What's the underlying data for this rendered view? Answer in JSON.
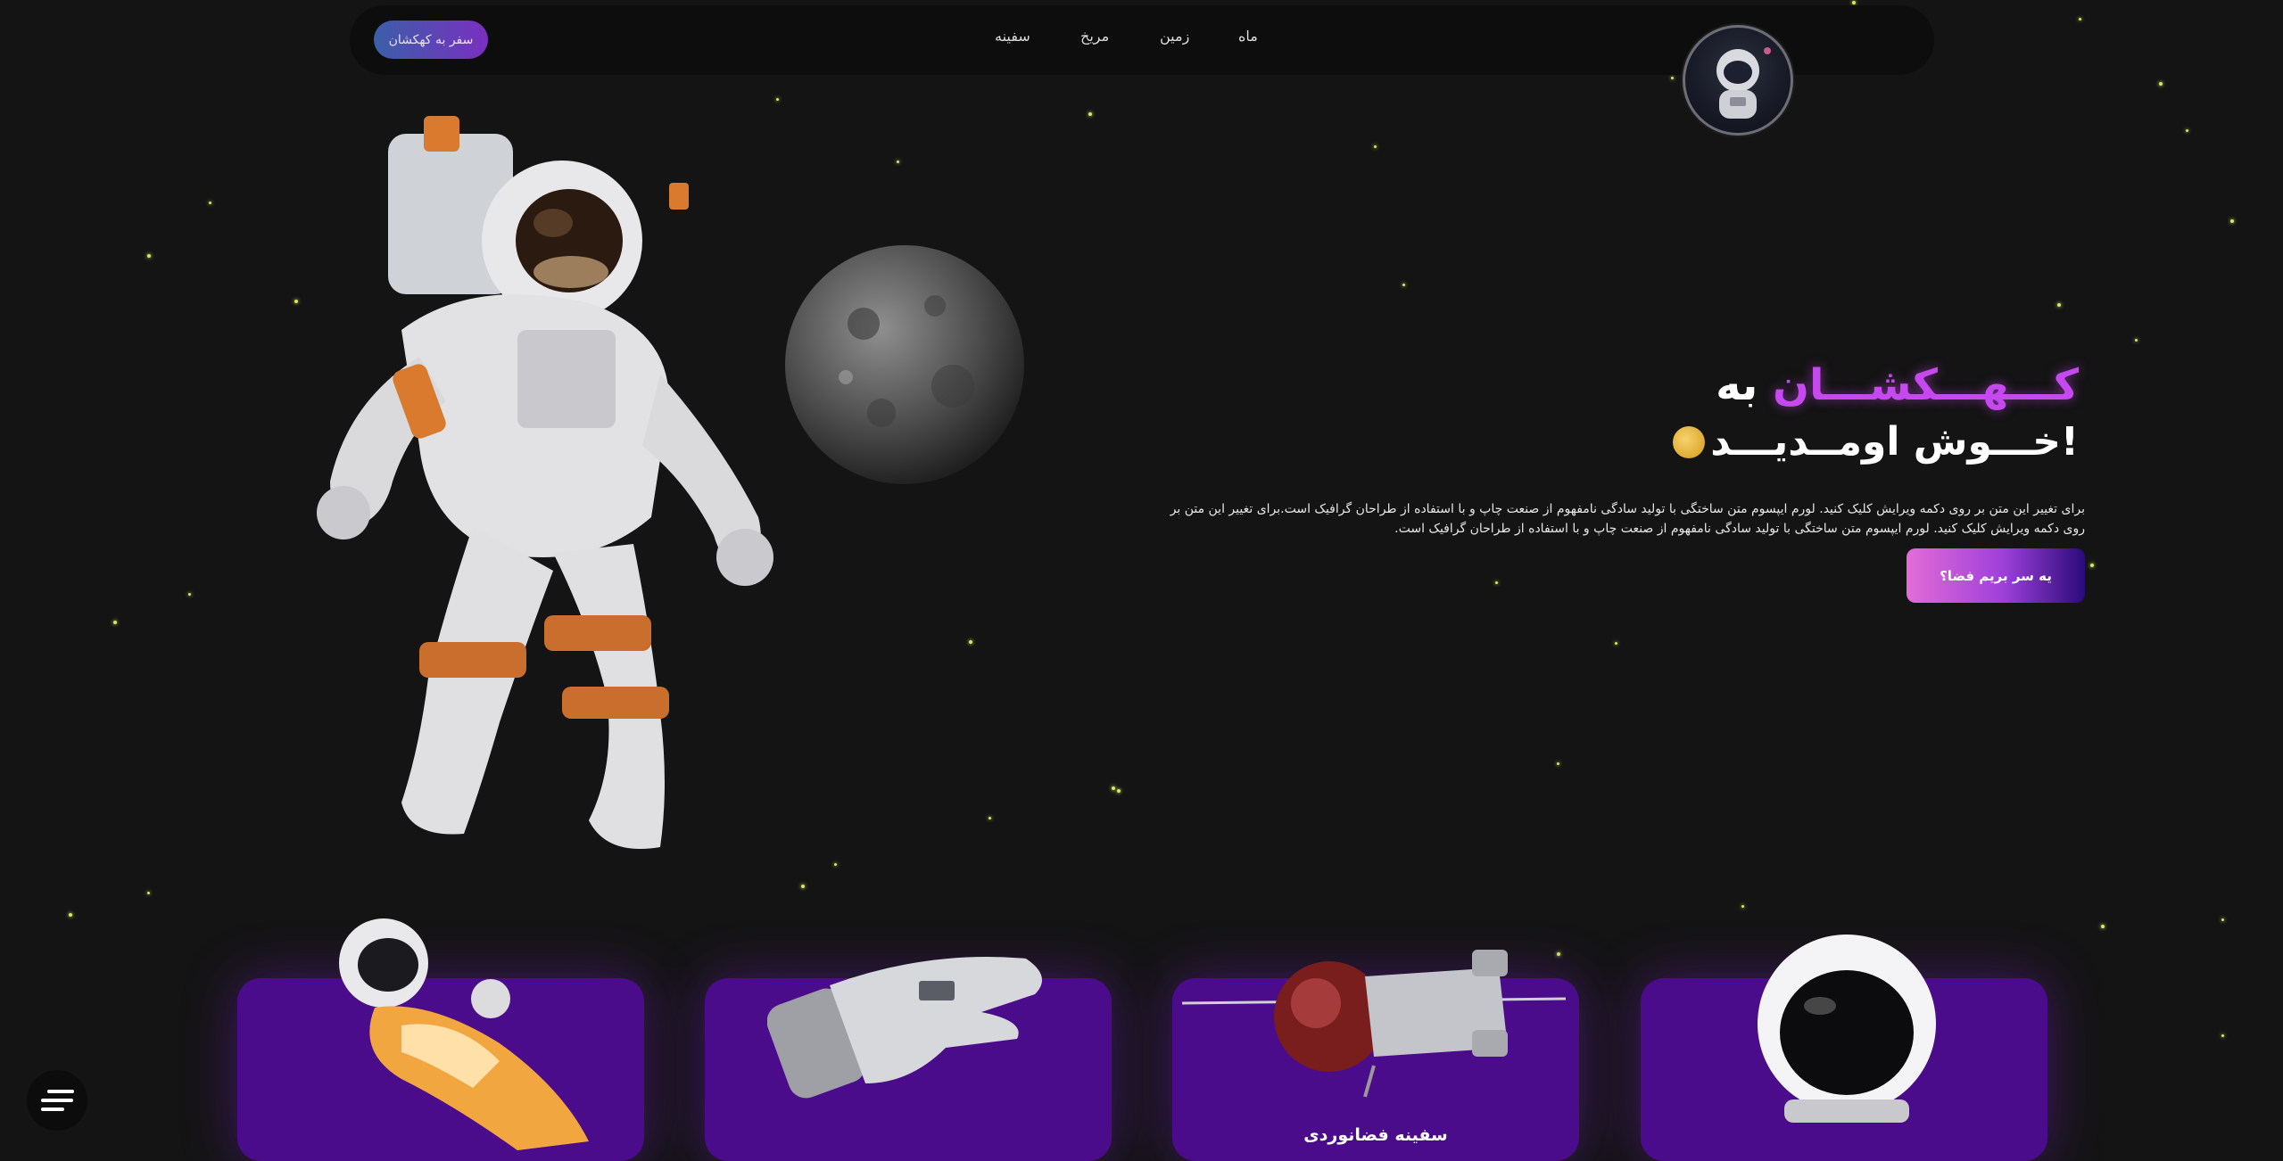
{
  "nav": {
    "cta": "سفر به کهکشان",
    "links": [
      "سفینه",
      "مریخ",
      "زمین",
      "ماه"
    ],
    "logo_icon": "astronaut-logo-icon"
  },
  "hero": {
    "title_prefix": "به",
    "title_accent": "کـــهـــکشـــان",
    "title_line2": "خـــوش اومــدیـــد!",
    "emoji_icon": "smiley-emoji-icon",
    "paragraph": "برای تغییر این متن بر روی دکمه ویرایش کلیک کنید. لورم ایپسوم متن ساختگی با تولید سادگی نامفهوم از صنعت چاپ و با استفاده از طراحان گرافیک است.برای تغییر این متن بر روی دکمه ویرایش کلیک کنید. لورم ایپسوم متن ساختگی با تولید سادگی نامفهوم از صنعت چاپ و با استفاده از طراحان گرافیک است.",
    "button": "یه سر بریم فضا؟"
  },
  "cards": [
    {
      "label": "",
      "icon": "astronaut-suit-icon"
    },
    {
      "label": "",
      "icon": "space-glove-icon"
    },
    {
      "label": "سفینه فضانوردی",
      "icon": "spaceship-icon"
    },
    {
      "label": "",
      "icon": "space-helmet-icon"
    }
  ],
  "colors": {
    "accent": "#c648ef",
    "card": "#4a0c8a",
    "background": "#141414"
  }
}
